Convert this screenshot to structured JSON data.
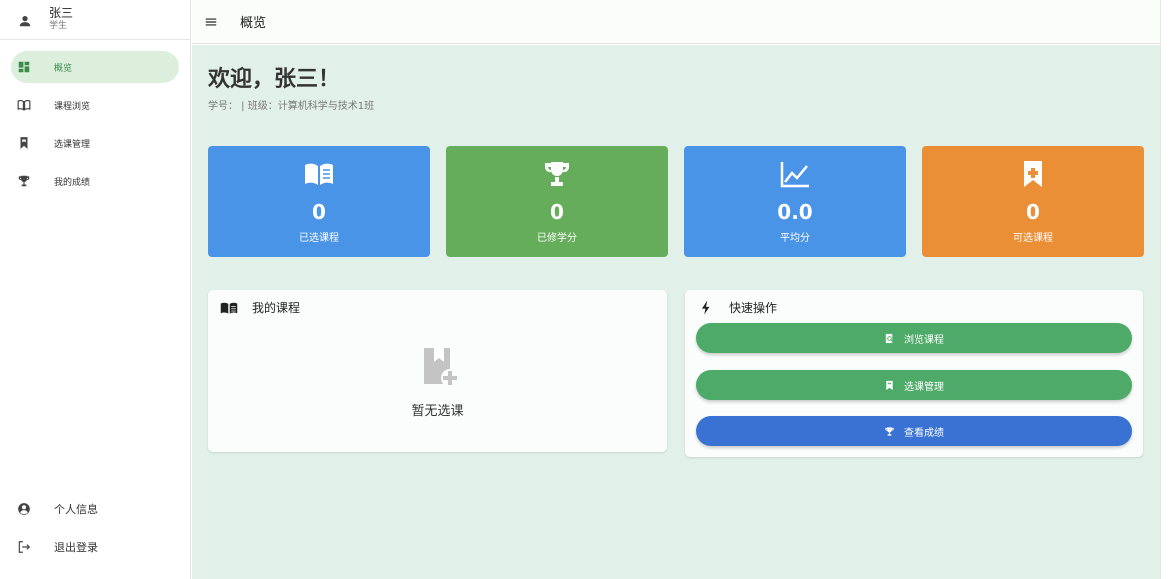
{
  "user": {
    "name": "张三",
    "role": "学生"
  },
  "sidebar": {
    "items": [
      {
        "label": "概览",
        "icon": "dashboard-icon",
        "active": true
      },
      {
        "label": "课程浏览",
        "icon": "book-open-icon"
      },
      {
        "label": "选课管理",
        "icon": "bookmark-icon"
      },
      {
        "label": "我的成绩",
        "icon": "trophy-icon"
      }
    ],
    "bottom": [
      {
        "label": "个人信息",
        "icon": "account-circle-icon"
      },
      {
        "label": "退出登录",
        "icon": "logout-icon"
      }
    ]
  },
  "topbar": {
    "title": "概览",
    "menu_icon": "menu-icon"
  },
  "welcome": {
    "title": "欢迎，张三！",
    "subtitle": "学号：  | 班级：计算机科学与技术1班"
  },
  "stats": [
    {
      "value": "0",
      "label": "已选课程",
      "icon": "book-open-icon",
      "color": "#4a94e8"
    },
    {
      "value": "0",
      "label": "已修学分",
      "icon": "trophy-icon",
      "color": "#66ad5b"
    },
    {
      "value": "0.0",
      "label": "平均分",
      "icon": "chart-line-icon",
      "color": "#4a94e8"
    },
    {
      "value": "0",
      "label": "可选课程",
      "icon": "bookmark-plus-icon",
      "color": "#ea8f35"
    }
  ],
  "my_courses": {
    "title": "我的课程",
    "empty_text": "暂无选课"
  },
  "quick_actions": {
    "title": "快速操作",
    "buttons": [
      {
        "label": "浏览课程",
        "color": "#4eaa68"
      },
      {
        "label": "选课管理",
        "color": "#4eaa68"
      },
      {
        "label": "查看成绩",
        "color": "#3a72d3"
      }
    ]
  }
}
